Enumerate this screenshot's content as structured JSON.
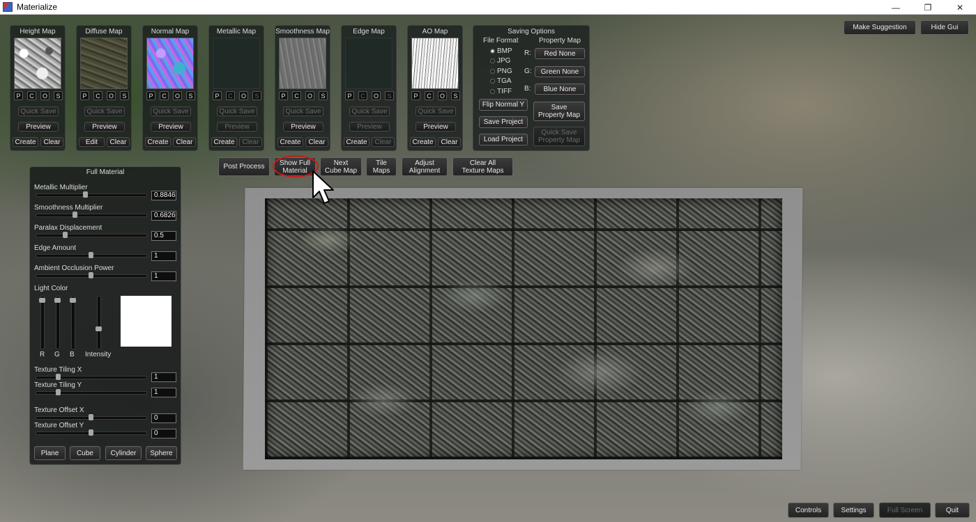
{
  "window": {
    "title": "Materialize",
    "minimize": "—",
    "maximize": "❐",
    "close": "✕"
  },
  "top_right": {
    "make_suggestion": "Make Suggestion",
    "hide_gui": "Hide Gui"
  },
  "map_panels": [
    {
      "title": "Height Map",
      "p": "P",
      "c": "C",
      "o": "O",
      "s": "S",
      "quick_save": "Quick Save",
      "preview": "Preview",
      "left": "Create",
      "right": "Clear"
    },
    {
      "title": "Diffuse Map",
      "p": "P",
      "c": "C",
      "o": "O",
      "s": "S",
      "quick_save": "Quick Save",
      "preview": "Preview",
      "left": "Edit",
      "right": "Clear"
    },
    {
      "title": "Normal Map",
      "p": "P",
      "c": "C",
      "o": "O",
      "s": "S",
      "quick_save": "Quick Save",
      "preview": "Preview",
      "left": "Create",
      "right": "Clear"
    },
    {
      "title": "Metallic Map",
      "p": "P",
      "c": "C",
      "o": "O",
      "s": "S",
      "quick_save": "Quick Save",
      "preview": "Preview",
      "left": "Create",
      "right": "Clear"
    },
    {
      "title": "Smoothness Map",
      "p": "P",
      "c": "C",
      "o": "O",
      "s": "S",
      "quick_save": "Quick Save",
      "preview": "Preview",
      "left": "Create",
      "right": "Clear"
    },
    {
      "title": "Edge Map",
      "p": "P",
      "c": "C",
      "o": "O",
      "s": "S",
      "quick_save": "Quick Save",
      "preview": "Preview",
      "left": "Create",
      "right": "Clear"
    },
    {
      "title": "AO Map",
      "p": "P",
      "c": "C",
      "o": "O",
      "s": "S",
      "quick_save": "Quick Save",
      "preview": "Preview",
      "left": "Create",
      "right": "Clear"
    }
  ],
  "saving": {
    "title": "Saving Options",
    "file_format": "File Format",
    "property_map": "Property Map",
    "formats": [
      "BMP",
      "JPG",
      "PNG",
      "TGA",
      "TIFF"
    ],
    "selected_format": "BMP",
    "r_label": "R:",
    "g_label": "G:",
    "b_label": "B:",
    "red": "Red None",
    "green": "Green None",
    "blue": "Blue None",
    "flip_normal": "Flip Normal Y",
    "save_project": "Save Project",
    "load_project": "Load Project",
    "save_property": "Save\nProperty Map",
    "quick_save_property": "Quick Save\nProperty Map"
  },
  "toolbar": {
    "post_process": "Post Process",
    "show_full": "Show Full\nMaterial",
    "next_cube": "Next\nCube Map",
    "tile_maps": "Tile\nMaps",
    "adjust": "Adjust\nAlignment",
    "clear_all": "Clear All\nTexture Maps"
  },
  "full_material": {
    "title": "Full Material",
    "metallic_label": "Metallic Multiplier",
    "metallic_value": "0.8846",
    "smoothness_label": "Smoothness Multiplier",
    "smoothness_value": "0.6826",
    "parallax_label": "Paralax Displacement",
    "parallax_value": "0.5",
    "edge_label": "Edge Amount",
    "edge_value": "1",
    "ao_label": "Ambient Occlusion Power",
    "ao_value": "1",
    "light_color": "Light Color",
    "r": "R",
    "g": "G",
    "b": "B",
    "intensity": "Intensity",
    "tiling_x_label": "Texture Tiling X",
    "tiling_x_value": "1",
    "tiling_y_label": "Texture Tiling Y",
    "tiling_y_value": "1",
    "offset_x_label": "Texture Offset X",
    "offset_x_value": "0",
    "offset_y_label": "Texture Offset Y",
    "offset_y_value": "0",
    "plane": "Plane",
    "cube": "Cube",
    "cylinder": "Cylinder",
    "sphere": "Sphere"
  },
  "bottom": {
    "controls": "Controls",
    "settings": "Settings",
    "full_screen": "Full Screen",
    "quit": "Quit"
  }
}
